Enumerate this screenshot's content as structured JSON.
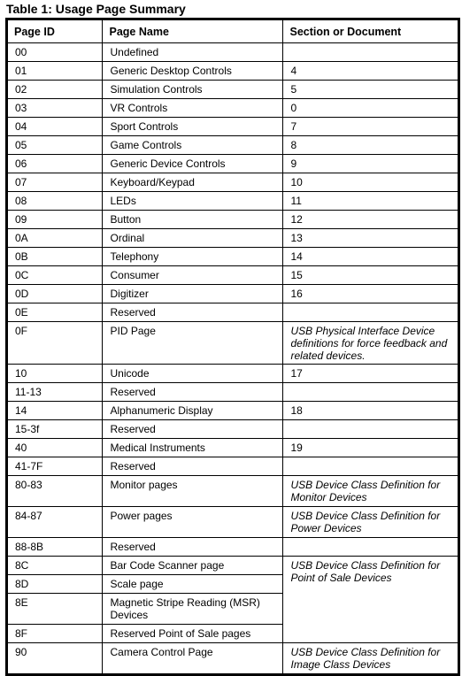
{
  "caption": "Table 1: Usage Page Summary",
  "table": {
    "headers": [
      "Page ID",
      "Page Name",
      "Section or Document"
    ],
    "rows": [
      {
        "id": "00",
        "name": "Undefined",
        "section": ""
      },
      {
        "id": "01",
        "name": "Generic Desktop Controls",
        "section": "4"
      },
      {
        "id": "02",
        "name": "Simulation Controls",
        "section": "5"
      },
      {
        "id": "03",
        "name": "VR Controls",
        "section": "0"
      },
      {
        "id": "04",
        "name": "Sport Controls",
        "section": "7"
      },
      {
        "id": "05",
        "name": "Game Controls",
        "section": "8"
      },
      {
        "id": "06",
        "name": "Generic Device Controls",
        "section": "9"
      },
      {
        "id": "07",
        "name": "Keyboard/Keypad",
        "section": "10"
      },
      {
        "id": "08",
        "name": "LEDs",
        "section": "11"
      },
      {
        "id": "09",
        "name": "Button",
        "section": "12"
      },
      {
        "id": "0A",
        "name": "Ordinal",
        "section": "13"
      },
      {
        "id": "0B",
        "name": "Telephony",
        "section": "14"
      },
      {
        "id": "0C",
        "name": "Consumer",
        "section": "15"
      },
      {
        "id": "0D",
        "name": "Digitizer",
        "section": "16"
      },
      {
        "id": "0E",
        "name": "Reserved",
        "section": ""
      },
      {
        "id": "0F",
        "name": "PID Page",
        "section": "USB Physical Interface Device definitions for force feedback and related devices.",
        "italic": true
      },
      {
        "id": "10",
        "name": "Unicode",
        "section": "17"
      },
      {
        "id": "11-13",
        "name": "Reserved",
        "section": ""
      },
      {
        "id": "14",
        "name": "Alphanumeric Display",
        "section": "18"
      },
      {
        "id": "15-3f",
        "name": "Reserved",
        "section": ""
      },
      {
        "id": "40",
        "name": "Medical Instruments",
        "section": "19"
      },
      {
        "id": "41-7F",
        "name": "Reserved",
        "section": ""
      },
      {
        "id": "80-83",
        "name": "Monitor pages",
        "section": "USB Device Class Definition for Monitor Devices",
        "italic": true
      },
      {
        "id": "84-87",
        "name": "Power pages",
        "section": "USB Device Class Definition for Power Devices",
        "italic": true
      },
      {
        "id": "88-8B",
        "name": "Reserved",
        "section": ""
      },
      {
        "id": "8C",
        "name": "Bar Code Scanner page",
        "section": "USB Device Class Definition for Point of Sale Devices",
        "italic": true,
        "rowspan": 4
      },
      {
        "id": "8D",
        "name": "Scale page",
        "merged": true
      },
      {
        "id": "8E",
        "name": "Magnetic Stripe Reading (MSR) Devices",
        "merged": true
      },
      {
        "id": "8F",
        "name": "Reserved Point of Sale pages",
        "merged": true
      },
      {
        "id": "90",
        "name": "Camera Control Page",
        "section": "USB Device Class Definition for Image Class Devices",
        "italic": true
      }
    ]
  }
}
